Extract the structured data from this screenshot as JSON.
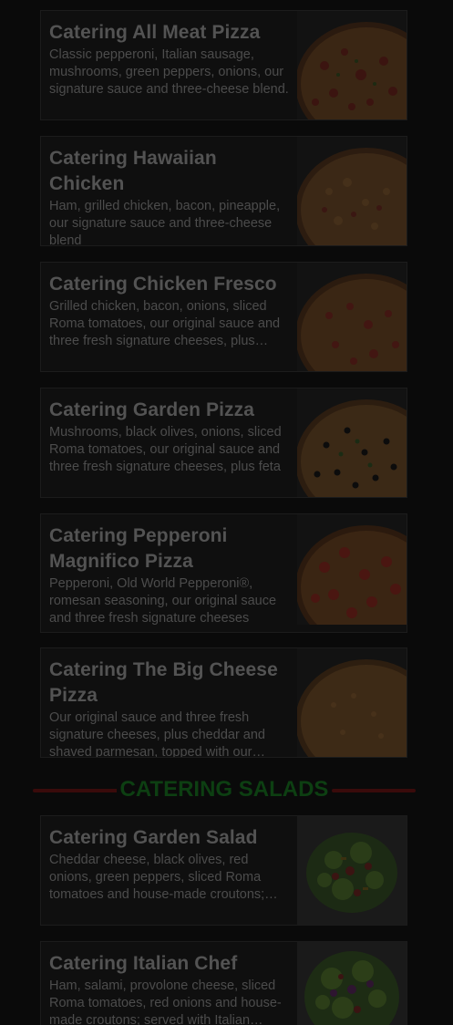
{
  "pizzas": [
    {
      "title": "Catering All Meat Pizza",
      "description": "Classic pepperoni, Italian sausage, mushrooms, green peppers, onions, our signature sauce and three-cheese blend.",
      "image": "all-meat-pizza-photo"
    },
    {
      "title": "Catering Hawaiian Chicken",
      "description": "Ham, grilled chicken, bacon, pineapple, our signature sauce and three-cheese blend",
      "image": "hawaiian-chicken-pizza-photo"
    },
    {
      "title": "Catering Chicken Fresco",
      "description": "Grilled chicken, bacon, onions, sliced Roma tomatoes, our original sauce and three fresh signature cheeses, plus…",
      "image": "chicken-fresco-pizza-photo"
    },
    {
      "title": "Catering Garden Pizza",
      "description": "Mushrooms, black olives, onions, sliced Roma tomatoes, our original sauce and three fresh signature cheeses, plus feta",
      "image": "garden-pizza-photo"
    },
    {
      "title": "Catering Pepperoni Magnifico Pizza",
      "description": "Pepperoni, Old World Pepperoni®, romesan seasoning, our original sauce and three fresh signature cheeses",
      "image": "pepperoni-magnifico-pizza-photo"
    },
    {
      "title": "Catering The Big Cheese Pizza",
      "description": "Our original sauce and three fresh signature cheeses, plus cheddar and shaved parmesan, topped with our…",
      "image": "big-cheese-pizza-photo"
    }
  ],
  "salads_section": {
    "title": "CATERING SALADS"
  },
  "salads": [
    {
      "title": "Catering Garden Salad",
      "description": "Cheddar cheese, black olives, red onions, green peppers, sliced Roma tomatoes and house-made croutons; served with…",
      "image": "garden-salad-photo"
    },
    {
      "title": "Catering Italian Chef",
      "description": "Ham, salami, provolone cheese, sliced Roma tomatoes, red onions and house-made croutons; served with Italian…",
      "image": "italian-chef-salad-photo"
    }
  ],
  "colors": {
    "overlay_background": "#0a0a0a",
    "title_text": "#535353",
    "section_title": "#0d3f12",
    "section_line": "#3a0b0b"
  }
}
